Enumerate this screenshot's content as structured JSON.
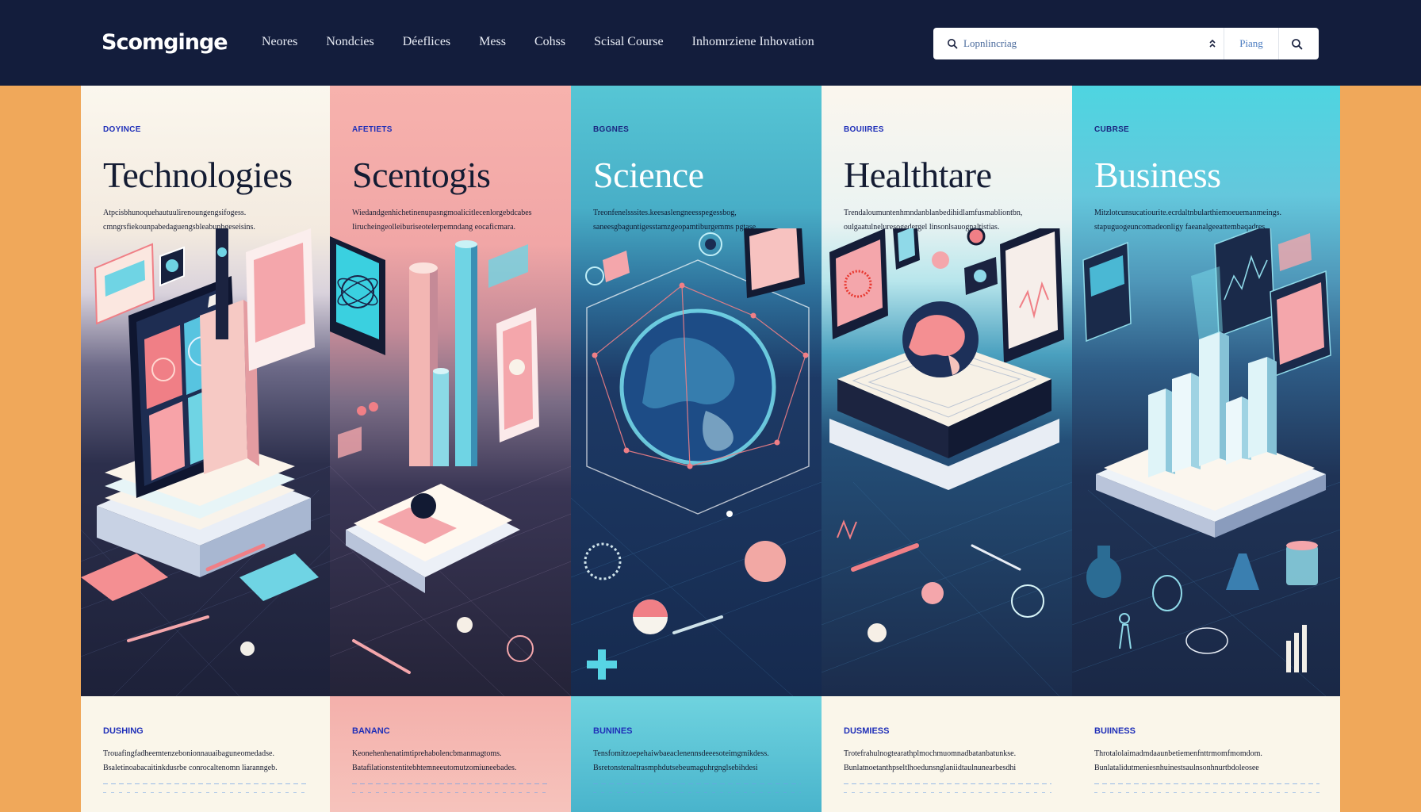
{
  "header": {
    "brand": "Scomginge",
    "menu": [
      "Neores",
      "Nondcies",
      "Déeflices",
      "Mess",
      "Cohss",
      "Scisal Course",
      "Inhomrziene Inhovation"
    ],
    "search": {
      "value": "Lopnlincriag",
      "plan_label": "Piang",
      "search_icon": "search-icon",
      "sort_icon": "sort-icon"
    }
  },
  "columns": [
    {
      "tag": "DOYINCE",
      "title": "Technologies",
      "desc": [
        "Atpcisbhunoquehautuulirenoungengsifogess.",
        "cmngrsfiekounpabedaguengsbleabunbgeseisins."
      ],
      "bottom_tag": "DUSHING",
      "bottom_l1": "Trouafingfadheemtenzebonionnauaibaguneomedadse.",
      "bottom_l2": "Bsaletinoabacaitinkdusrbe conrocaltenomn liaranngeb."
    },
    {
      "tag": "AFETIETS",
      "title": "Scentogis",
      "desc": [
        "Wiedandgenhichetinenupasngmoalicitlecenlorgebdcabes",
        "Iirucheingeolleiburiseotelerpemndang eocaficmara."
      ],
      "bottom_tag": "BANANC",
      "bottom_l1": "Keonehenhenatimtiprehabolencbmanmagtoms.",
      "bottom_l2": "Batafilationstentitebhtemneeutomutzomiuneebades."
    },
    {
      "tag": "BGGNES",
      "title": "Science",
      "desc": [
        "Treonfenelsssites.keesaslengneesspegessbog,",
        "saneesgbaguntigesstamzgeopamtiburgemms pgtase."
      ],
      "bottom_tag": "BUNINES",
      "bottom_l1": "Tensfomitzoepehaiwbaeaclenennsdeeesoteimgmikdess.",
      "bottom_l2": "Bsretonstenaltrasmphdutsebeumaguhrgnglsebihdesi"
    },
    {
      "tag": "BOUIIRES",
      "title": "Healthtare",
      "desc": [
        "Trendaloumuntenhmndanblanbedihidlamfusmabliontbn,",
        "oulgaatulneluresogedergel linsonlsauognaltistias."
      ],
      "desc_highlight": "linsonlsauognaltistias.",
      "bottom_tag": "DUSMIESS",
      "bottom_l1": "Trotefrahulnogtearathplmochmuomnadbatanbatunkse.",
      "bottom_l2": "Bunlatnoetanthpseltlhoedunsnglaniidtaulnunearbesdhi"
    },
    {
      "tag": "CUBRSE",
      "title": "Business",
      "desc": [
        "Mitzlotcunsucatiourite.ecrdaltnbularthiemoeuemanmeings.",
        "stapuguogeuncomadeonligy faeanalgeeattembaqadres."
      ],
      "bottom_tag": "BUIINESS",
      "bottom_l1": "Throtalolaimadmdaaunbetiemenfnttrmomfmomdom.",
      "bottom_l2": "Bunlatalidutmeniesnhuinestsaulnsonhnurtbdoleosee"
    }
  ],
  "colors": {
    "nav_bg": "#131d3c",
    "page_bg": "#f0a85a",
    "tag_blue": "#1f2fb8",
    "coral": "#f07f86",
    "cyan": "#57d4e4"
  }
}
